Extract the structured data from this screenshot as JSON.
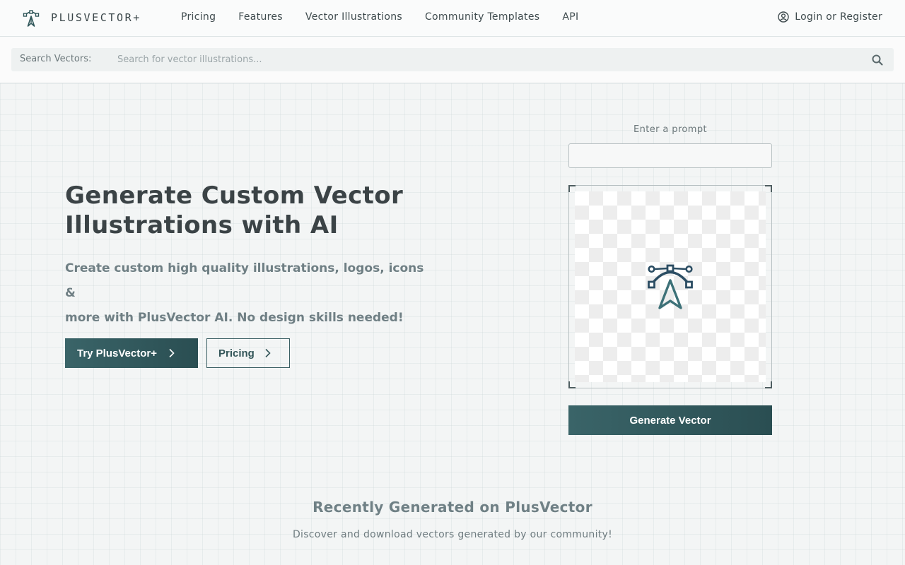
{
  "header": {
    "brand": "PLUSVECTOR+",
    "logo_icon": "pen-tool-icon",
    "nav": [
      {
        "label": "Pricing"
      },
      {
        "label": "Features"
      },
      {
        "label": "Vector Illustrations"
      },
      {
        "label": "Community Templates"
      },
      {
        "label": "API"
      }
    ],
    "login_label": "Login or Register",
    "login_icon": "user-circle-icon"
  },
  "search": {
    "label": "Search Vectors:",
    "placeholder": "Search for vector illustrations...",
    "value": "",
    "icon": "search-icon"
  },
  "hero": {
    "title_line1": "Generate Custom Vector",
    "title_line2": "Illustrations with AI",
    "subtitle_line1": "Create custom high quality illustrations, logos, icons &",
    "subtitle_line2": "more with PlusVector AI. No design skills needed!",
    "primary_button": "Try PlusVector+",
    "secondary_button": "Pricing"
  },
  "generator": {
    "prompt_label": "Enter a prompt",
    "prompt_value": "",
    "generate_button": "Generate Vector",
    "canvas_icon": "pen-tool-icon"
  },
  "recent": {
    "title": "Recently Generated on PlusVector",
    "subtitle": "Discover and download vectors generated by our community!"
  },
  "colors": {
    "accent": "#2f5659",
    "text_dark": "#3b4346",
    "text_muted": "#6f7f84",
    "background": "#f3f5f5"
  }
}
